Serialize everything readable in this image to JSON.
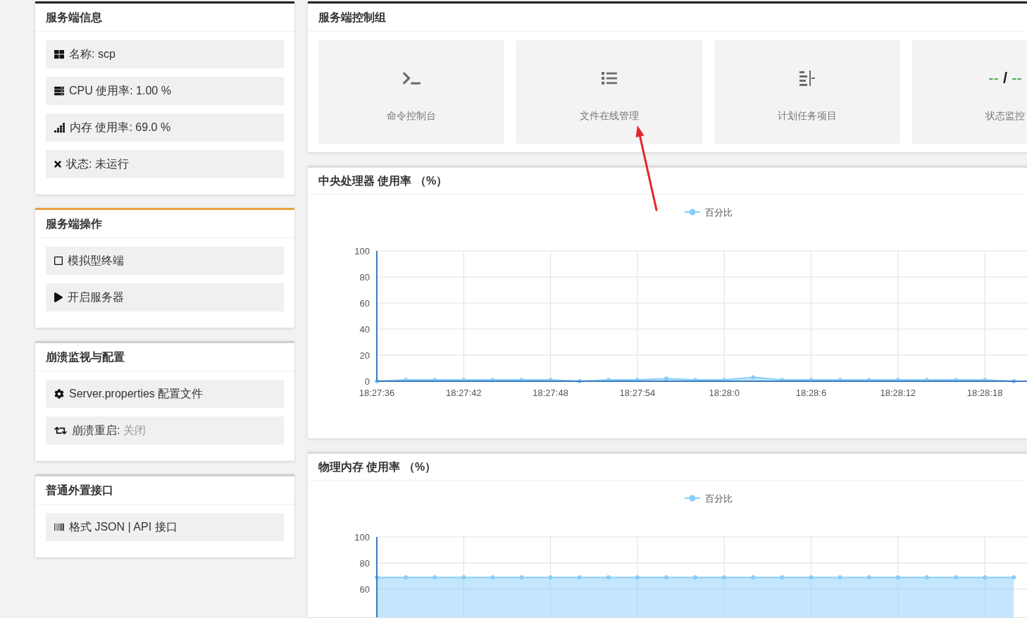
{
  "panels": [
    {
      "title": "服务端信息",
      "color": "#222222",
      "items": [
        {
          "label": "名称: scp"
        },
        {
          "label": "CPU 使用率: 1.00 %"
        },
        {
          "label": "内存 使用率: 69.0 %"
        },
        {
          "label": "状态: 未运行"
        }
      ]
    },
    {
      "title": "服务端操作",
      "color": "#e8a33d",
      "items": [
        {
          "label": "模拟型终端"
        },
        {
          "label": "开启服务器"
        }
      ]
    },
    {
      "title": "崩溃监视与配置",
      "color": "#cfcfcf",
      "items": [
        {
          "label": "Server.properties 配置文件"
        },
        {
          "label": "崩溃重启:",
          "value": "关闭"
        }
      ]
    },
    {
      "title": "普通外置接口",
      "color": "#cfcfcf",
      "items": [
        {
          "label": "格式 JSON | API 接口"
        }
      ]
    }
  ],
  "control_group": {
    "title": "服务端控制组",
    "tiles": [
      {
        "kind": "icon",
        "label": "命令控制台"
      },
      {
        "kind": "icon",
        "label": "文件在线管理"
      },
      {
        "kind": "icon",
        "label": "计划任务项目"
      },
      {
        "kind": "reading",
        "reading": {
          "left": "--",
          "separator": "/",
          "right": "--"
        },
        "label": "状态监控"
      }
    ]
  },
  "charts": [
    {
      "title": "中央处理器 使用率 （%）",
      "chart_data": {
        "type": "area",
        "grid": true,
        "categories": [
          "18:27:36",
          null,
          null,
          "18:27:42",
          null,
          null,
          "18:27:48",
          null,
          null,
          "18:27:54",
          null,
          null,
          "18:28:0",
          null,
          null,
          "18:28:6",
          null,
          null,
          "18:28:12",
          null,
          null,
          "18:28:18",
          null
        ],
        "ylim": [
          0,
          100
        ],
        "yticks": [
          0,
          20,
          40,
          60,
          80,
          100
        ],
        "series": [
          {
            "name": "百分比",
            "color": "#87cefa",
            "values": [
              0,
              1,
              1,
              1,
              1,
              1,
              1,
              0,
              1,
              1,
              2,
              1,
              1,
              3,
              1,
              1,
              1,
              1,
              1,
              1,
              1,
              1,
              0
            ]
          }
        ]
      }
    },
    {
      "title": "物理内存 使用率 （%）",
      "chart_data": {
        "type": "area",
        "grid": true,
        "ylim": [
          0,
          100
        ],
        "yticks": [
          60,
          80,
          100
        ],
        "series": [
          {
            "name": "百分比",
            "color": "#87cefa",
            "values": [
              69,
              69,
              69,
              69,
              69,
              69,
              69,
              69,
              69,
              69,
              69,
              69,
              69,
              69,
              69,
              69,
              69,
              69,
              69,
              69,
              69,
              69,
              69
            ]
          }
        ]
      }
    }
  ]
}
